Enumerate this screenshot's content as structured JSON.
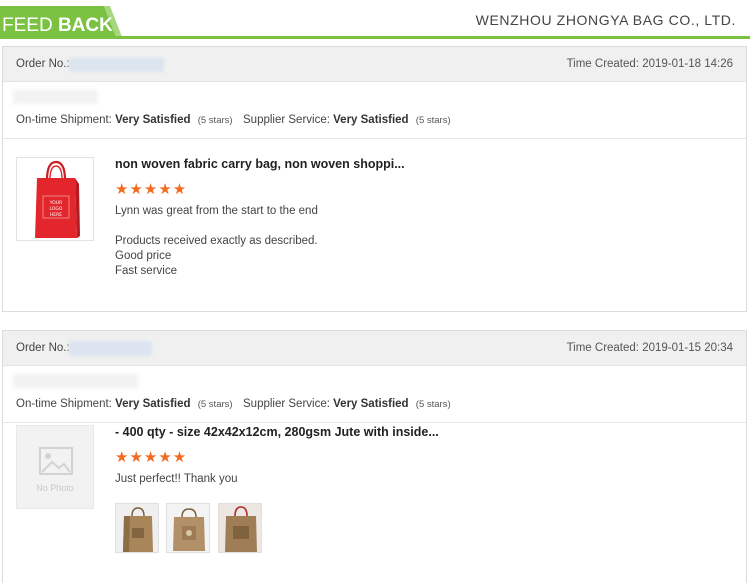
{
  "header": {
    "tab_light": "FEED ",
    "tab_bold": "BACK",
    "company": "WENZHOU ZHONGYA BAG CO., LTD.",
    "accent": "#7bc142"
  },
  "orders": [
    {
      "order_label": "Order No.:",
      "time_created": "Time Created: 2019-01-18 14:26",
      "shipment_label": "On-time Shipment:",
      "shipment_value": "Very Satisfied",
      "shipment_stars": "(5 stars)",
      "service_label": "Supplier Service:",
      "service_value": "Very Satisfied",
      "service_stars": "(5 stars)",
      "product_title": "non woven fabric carry bag, non woven shoppi...",
      "rating": 5,
      "stars": "★★★★★",
      "comment_line1": "Lynn was great from the start to the end",
      "comment_line2": "Products received exactly as described.",
      "comment_line3": "Good price",
      "comment_line4": "Fast service",
      "thumb_text": "YOUR LOGO HERE",
      "thumb_icon": "red-tote-bag"
    },
    {
      "order_label": "Order No.:",
      "time_created": "Time Created: 2019-01-15 20:34",
      "shipment_label": "On-time Shipment:",
      "shipment_value": "Very Satisfied",
      "shipment_stars": "(5 stars)",
      "service_label": "Supplier Service:",
      "service_value": "Very Satisfied",
      "service_stars": "(5 stars)",
      "product_title": "- 400 qty - size 42x42x12cm, 280gsm Jute with inside...",
      "rating": 5,
      "stars": "★★★★★",
      "comment_line1": "Just perfect!! Thank you",
      "nophoto_label": "No Photo",
      "photo_icons": [
        "jute-bag-photo-1",
        "jute-bag-photo-2",
        "jute-bag-photo-3"
      ]
    }
  ],
  "colors": {
    "star": "#f26b21",
    "bag_red": "#e3262c",
    "jute": "#a8865a"
  }
}
